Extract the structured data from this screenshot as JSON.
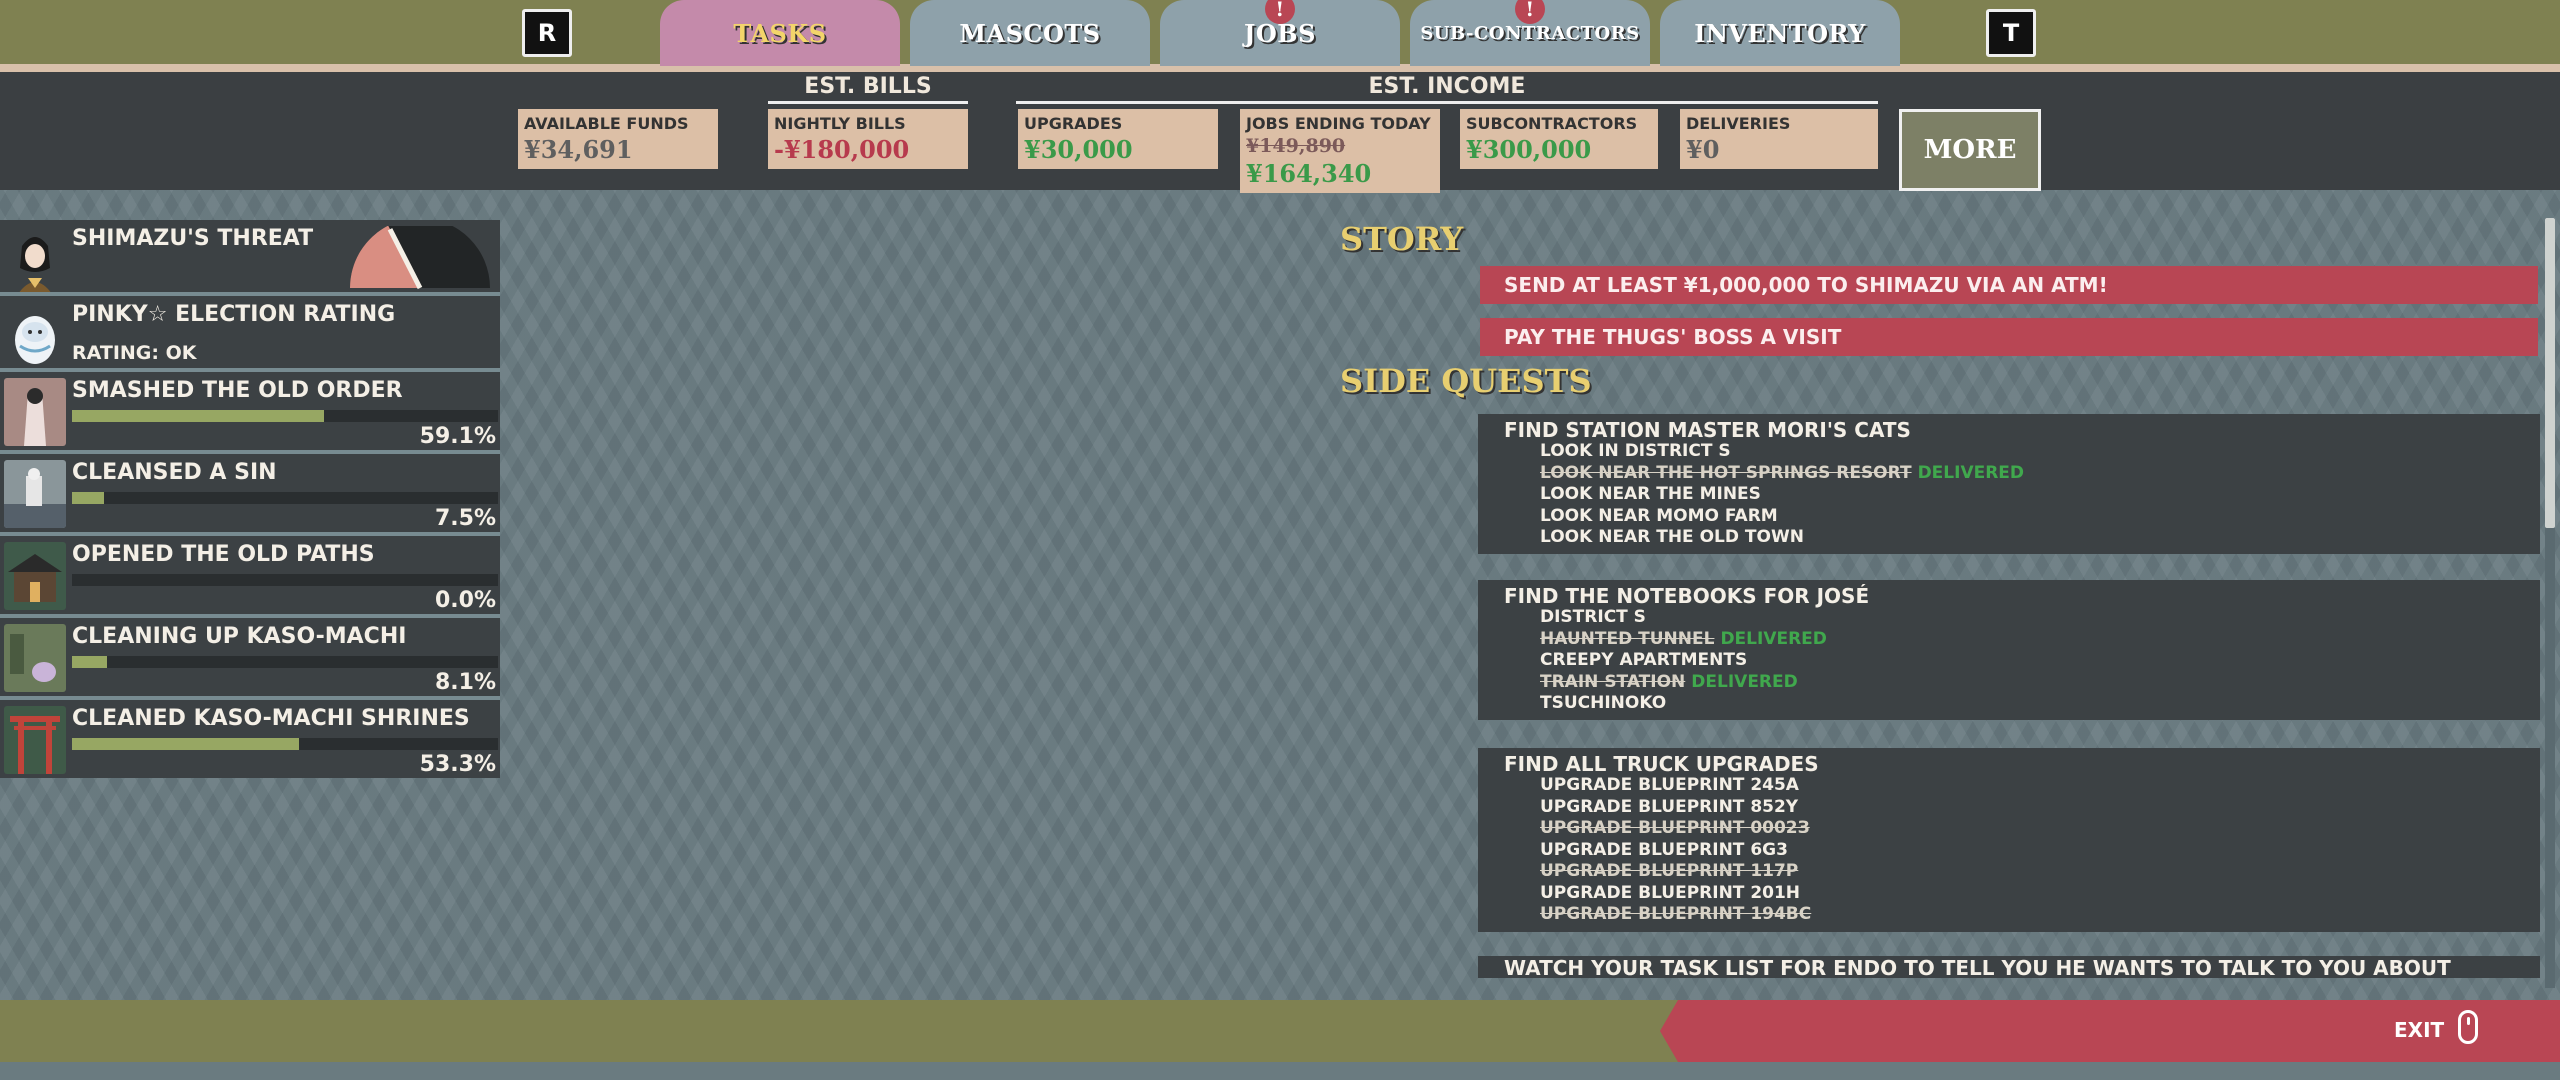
{
  "keys": {
    "left": "R",
    "right": "T"
  },
  "tabs": [
    {
      "label": "TASKS",
      "active": true,
      "alert": ""
    },
    {
      "label": "MASCOTS",
      "active": false,
      "alert": ""
    },
    {
      "label": "JOBS",
      "active": false,
      "alert": "!"
    },
    {
      "label": "SUB-CONTRACTORS",
      "active": false,
      "alert": "!"
    },
    {
      "label": "INVENTORY",
      "active": false,
      "alert": ""
    }
  ],
  "finance": {
    "bills_heading": "EST. BILLS",
    "income_heading": "EST. INCOME",
    "available_funds": {
      "label": "AVAILABLE FUNDS",
      "value": "¥34,691"
    },
    "nightly_bills": {
      "label": "NIGHTLY BILLS",
      "value": "-¥180,000"
    },
    "upgrades": {
      "label": "UPGRADES",
      "value": "¥30,000"
    },
    "jobs_ending": {
      "label": "JOBS ENDING TODAY",
      "old_value": "¥149,890",
      "value": "¥164,340"
    },
    "subcontractors": {
      "label": "SUBCONTRACTORS",
      "value": "¥300,000"
    },
    "deliveries": {
      "label": "DELIVERIES",
      "value": "¥0"
    },
    "more_label": "MORE"
  },
  "stats": [
    {
      "title": "SHIMAZU'S THREAT",
      "kind": "gauge",
      "gauge_level": 0.35
    },
    {
      "title": "PINKY☆ ELECTION RATING",
      "sub": "RATING: OK",
      "kind": "rating"
    },
    {
      "title": "SMASHED THE OLD ORDER",
      "pct": "59.1%",
      "fraction": 0.591
    },
    {
      "title": "CLEANSED A SIN",
      "pct": "7.5%",
      "fraction": 0.075
    },
    {
      "title": "OPENED THE OLD PATHS",
      "pct": "0.0%",
      "fraction": 0.0
    },
    {
      "title": "CLEANING UP KASO-MACHI",
      "pct": "8.1%",
      "fraction": 0.081
    },
    {
      "title": "CLEANED KASO-MACHI SHRINES",
      "pct": "53.3%",
      "fraction": 0.533
    }
  ],
  "story": {
    "heading": "STORY",
    "items": [
      "SEND AT LEAST ¥1,000,000 TO SHIMAZU VIA AN ATM!",
      "PAY THE THUGS' BOSS A VISIT"
    ]
  },
  "side_quests": {
    "heading": "SIDE QUESTS",
    "quests": [
      {
        "title": "FIND STATION MASTER MORI'S CATS",
        "items": [
          {
            "text": "LOOK IN DISTRICT S",
            "done": false
          },
          {
            "text": "LOOK NEAR THE HOT SPRINGS RESORT",
            "done": true,
            "status": "DELIVERED"
          },
          {
            "text": "LOOK NEAR THE MINES",
            "done": false
          },
          {
            "text": "LOOK NEAR MOMO FARM",
            "done": false
          },
          {
            "text": "LOOK NEAR THE OLD TOWN",
            "done": false
          }
        ]
      },
      {
        "title": "FIND THE NOTEBOOKS FOR JOSÉ",
        "items": [
          {
            "text": "DISTRICT S",
            "done": false
          },
          {
            "text": "HAUNTED TUNNEL",
            "done": true,
            "status": "DELIVERED"
          },
          {
            "text": "CREEPY APARTMENTS",
            "done": false
          },
          {
            "text": "TRAIN STATION",
            "done": true,
            "status": "DELIVERED"
          },
          {
            "text": "TSUCHINOKO",
            "done": false
          }
        ]
      },
      {
        "title": "FIND ALL TRUCK UPGRADES",
        "items": [
          {
            "text": "UPGRADE BLUEPRINT 245A",
            "done": false
          },
          {
            "text": "UPGRADE BLUEPRINT 852Y",
            "done": false
          },
          {
            "text": "UPGRADE BLUEPRINT 0002З",
            "done": true
          },
          {
            "text": "UPGRADE BLUEPRINT 6G3",
            "done": false
          },
          {
            "text": "UPGRADE BLUEPRINT 117P",
            "done": true
          },
          {
            "text": "UPGRADE BLUEPRINT 201H",
            "done": false
          },
          {
            "text": "UPGRADE BLUEPRINT 194BC",
            "done": true
          }
        ]
      },
      {
        "title": "WATCH YOUR TASK LIST FOR ENDO TO TELL YOU HE WANTS TO TALK TO YOU ABOUT BUSINESSES",
        "items": []
      }
    ]
  },
  "footer": {
    "exit_label": "EXIT"
  },
  "colors": {
    "accent_red": "#b94654",
    "accent_gold": "#e8cf70",
    "bar_green": "#97a763",
    "delivered_green": "#40a84d"
  }
}
